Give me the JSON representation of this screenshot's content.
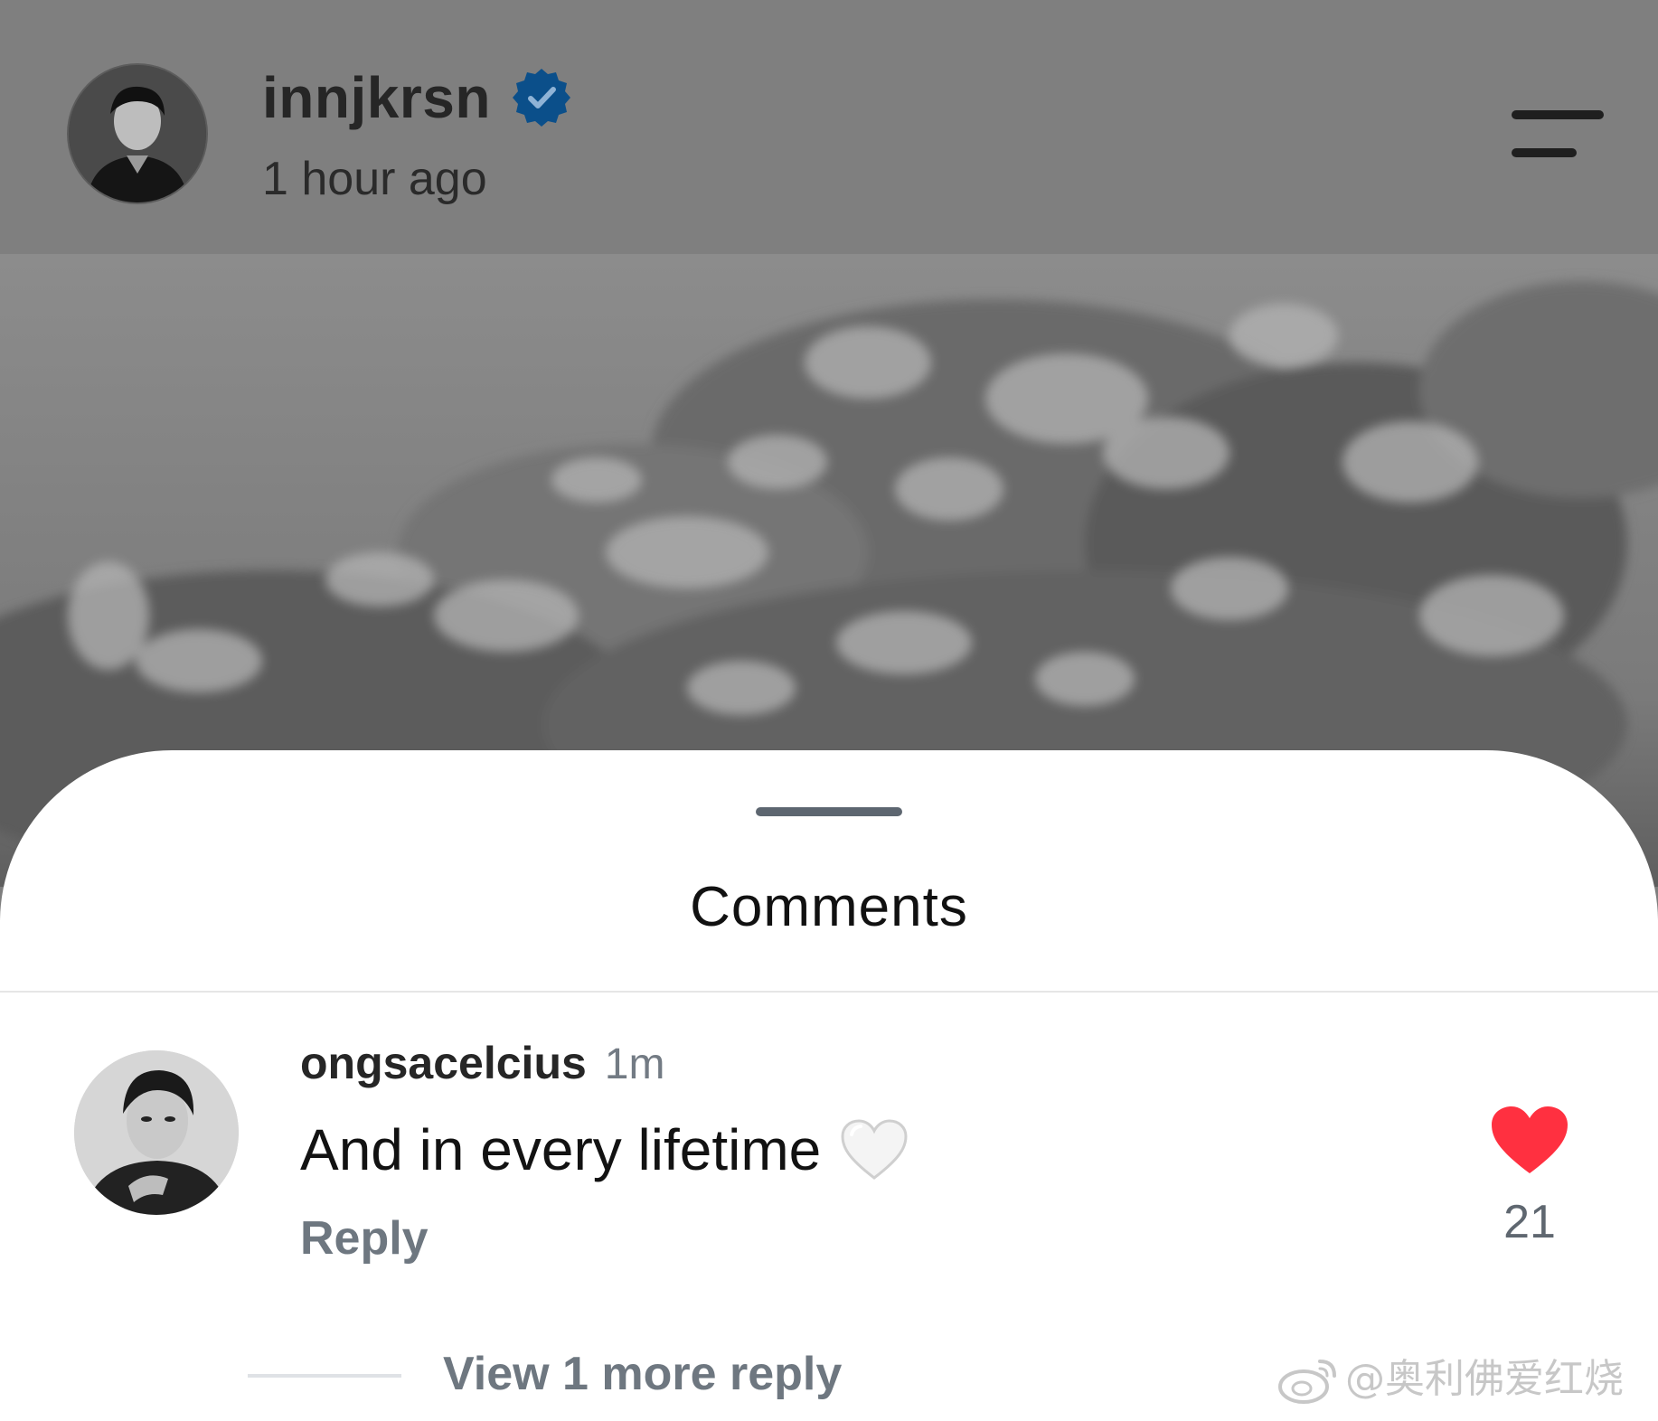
{
  "post_header": {
    "author_name": "innjkrsn",
    "verified": true,
    "post_time": "1 hour ago",
    "avatar_icon": "profile-photo",
    "menu_icon": "menu-icon"
  },
  "post_image": {
    "description_icon": "blurred-foliage-photo"
  },
  "comments_sheet": {
    "title": "Comments",
    "comments": [
      {
        "username": "ongsacelcius",
        "time": "1m",
        "text": "And in every lifetime",
        "emoji_icon": "white-heart-icon",
        "reply_label": "Reply",
        "like_icon": "heart-icon",
        "liked": true,
        "like_count": "21",
        "view_replies_label": "View 1 more reply"
      }
    ]
  },
  "watermark": {
    "text": "@奥利佛爱红烧",
    "icon": "weibo-logo"
  },
  "colors": {
    "overlay_gray": "#7f7f7f",
    "verified_blue": "#0b4f8a",
    "like_red": "#ff3040",
    "secondary_text": "#6e7780",
    "primary_text": "#121212"
  }
}
